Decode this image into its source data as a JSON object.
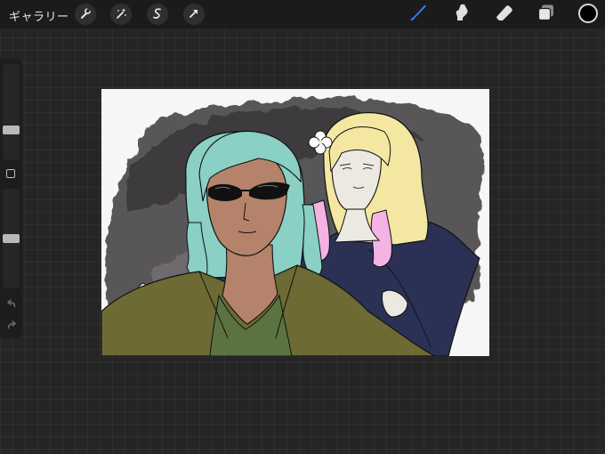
{
  "toolbar": {
    "gallery_label": "ギャラリー",
    "left_tools": [
      {
        "name": "wrench-icon"
      },
      {
        "name": "magic-wand-icon"
      },
      {
        "name": "selection-icon"
      },
      {
        "name": "transform-arrow-icon"
      }
    ],
    "right_tools": [
      {
        "name": "brush-icon",
        "active": true
      },
      {
        "name": "smudge-icon",
        "active": false
      },
      {
        "name": "eraser-icon",
        "active": false
      },
      {
        "name": "layers-icon",
        "active": false
      }
    ],
    "active_color": "#000000",
    "accent_color": "#2f7bff"
  },
  "sidebar": {
    "brush_size_level": 0.3,
    "opacity_level": 0.5,
    "icons": [
      "modifier-square-icon",
      "undo-icon",
      "redo-icon"
    ]
  },
  "canvas": {
    "background": "#f6f6f6",
    "content": "illustration-two-characters"
  }
}
